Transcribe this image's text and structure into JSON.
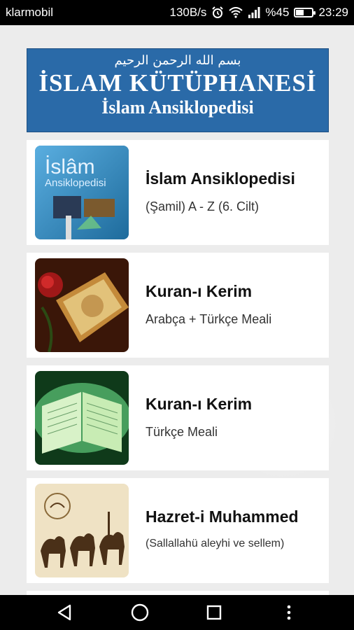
{
  "status": {
    "carrier": "klarmobil",
    "speed": "130B/s",
    "battery_text": "%45",
    "time": "23:29",
    "battery_level": 0.45
  },
  "banner": {
    "arabic": "بسم الله الرحمن الرحيم",
    "title": "İSLAM KÜTÜPHANESİ",
    "subtitle": "İslam Ansiklopedisi"
  },
  "items": [
    {
      "title": "İslam Ansiklopedisi",
      "subtitle": "(Şamil) A - Z (6. Cilt)",
      "icon": "encyclopedia-cover"
    },
    {
      "title": "Kuran-ı Kerim",
      "subtitle": "Arabça + Türkçe Meali",
      "icon": "quran-rose-image"
    },
    {
      "title": "Kuran-ı Kerim",
      "subtitle": "Türkçe Meali",
      "icon": "quran-open-book-image"
    },
    {
      "title": "Hazret-i Muhammed",
      "subtitle": "(Sallallahü aleyhi ve sellem)",
      "icon": "camel-caravan-image"
    }
  ],
  "colors": {
    "banner_bg": "#2a6aa8",
    "background": "#ececec"
  }
}
